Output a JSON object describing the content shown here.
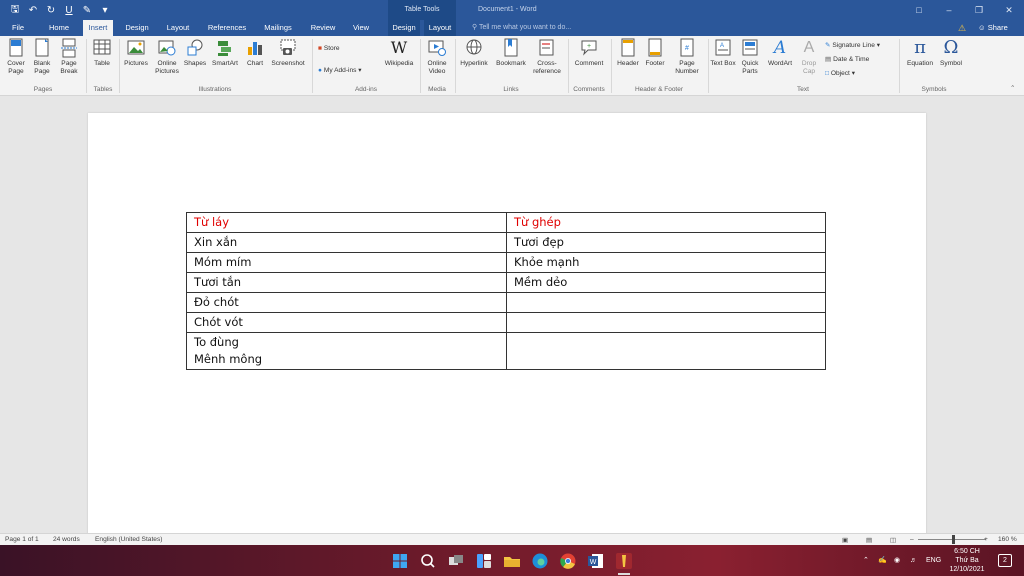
{
  "titlebar": {
    "context_title": "Table Tools",
    "doc_title": "Document1  -  Word",
    "qat": [
      "save-icon",
      "undo-icon",
      "redo-icon",
      "underline-icon",
      "format-painter-icon",
      "customize-icon"
    ]
  },
  "tabs": {
    "file": "File",
    "home": "Home",
    "insert": "Insert",
    "design": "Design",
    "layout": "Layout",
    "references": "References",
    "mailings": "Mailings",
    "review": "Review",
    "view": "View",
    "table_design": "Design",
    "table_layout": "Layout",
    "tellme": "Tell me what you want to do...",
    "share": "Share"
  },
  "ribbon": {
    "cover_page": "Cover Page",
    "blank_page": "Blank Page",
    "page_break": "Page Break",
    "group_pages": "Pages",
    "table": "Table",
    "group_tables": "Tables",
    "pictures": "Pictures",
    "online_pictures": "Online Pictures",
    "shapes": "Shapes",
    "smartart": "SmartArt",
    "chart": "Chart",
    "screenshot": "Screenshot",
    "group_illustrations": "Illustrations",
    "store": "Store",
    "my_addins": "My Add-ins",
    "wikipedia": "Wikipedia",
    "group_addins": "Add-ins",
    "online_video": "Online Video",
    "group_media": "Media",
    "hyperlink": "Hyperlink",
    "bookmark": "Bookmark",
    "cross_reference": "Cross-reference",
    "group_links": "Links",
    "comment": "Comment",
    "group_comments": "Comments",
    "header": "Header",
    "footer": "Footer",
    "page_number": "Page Number",
    "group_header_footer": "Header & Footer",
    "text_box": "Text Box",
    "quick_parts": "Quick Parts",
    "wordart": "WordArt",
    "drop_cap": "Drop Cap",
    "signature_line": "Signature Line",
    "date_time": "Date & Time",
    "object": "Object",
    "group_text": "Text",
    "equation": "Equation",
    "symbol": "Symbol",
    "group_symbols": "Symbols"
  },
  "table": {
    "header": [
      "Từ láy",
      "Từ ghép"
    ],
    "header_color": "#e00000",
    "rows": [
      [
        "Xin xắn",
        "Tươi đẹp"
      ],
      [
        "Móm mím",
        "Khỏe mạnh"
      ],
      [
        "Tươi tắn",
        "Mềm dẻo"
      ],
      [
        "Đỏ chót",
        ""
      ],
      [
        "Chót vót",
        ""
      ]
    ],
    "last_row": {
      "line1": "To đùng",
      "line2": "Mênh mông",
      "col2": ""
    }
  },
  "status": {
    "page": "Page 1 of 1",
    "words": "24 words",
    "language": "English (United States)",
    "zoom": "160 %"
  },
  "taskbar": {
    "time": "6:50 CH",
    "day": "Thứ Ba",
    "date": "12/10/2021",
    "lang": "ENG",
    "notifications": "2"
  },
  "colors": {
    "brand": "#2b579a",
    "ribbon_bg": "#f3f3f3"
  }
}
